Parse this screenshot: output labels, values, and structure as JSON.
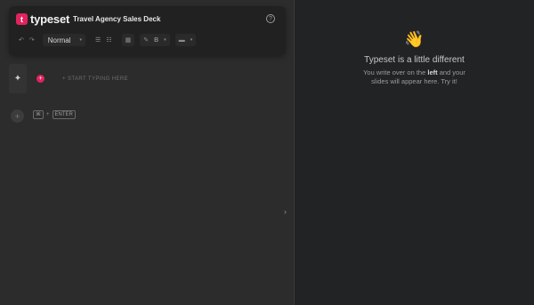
{
  "app": {
    "logo_letter": "t",
    "name": "typeset",
    "document_title": "Travel Agency Sales Deck",
    "help_glyph": "?"
  },
  "toolbar": {
    "undo_glyph": "↶",
    "redo_glyph": "↷",
    "text_style": "Normal",
    "dropdown_caret": "▾",
    "bullet_list_glyph": "☰",
    "numbered_list_glyph": "☷",
    "layout_glyph": "▦",
    "highlighter_glyph": "✎",
    "bold_label": "B",
    "image_glyph": "▬",
    "icons": [
      "undo-icon",
      "redo-icon",
      "bullet-list-icon",
      "numbered-list-icon",
      "layout-icon",
      "highlighter-icon",
      "image-icon"
    ]
  },
  "editor": {
    "magic_glyph": "✦",
    "marker_glyph": "+",
    "placeholder": "+ START TYPING HERE",
    "add_glyph": "+",
    "shortcut_cmd": "⌘",
    "shortcut_plus": "+",
    "shortcut_enter": "ENTER",
    "collapse_glyph": "›"
  },
  "preview": {
    "emoji": "👋",
    "title": "Typeset is a little different",
    "body_before": "You write over on the ",
    "body_bold": "left",
    "body_after": " and your slides will appear here. Try it!"
  },
  "colors": {
    "accent": "#e0245e",
    "left_bg": "#2c2c2c",
    "right_bg": "#222324",
    "toolbar_bg": "#212121"
  }
}
